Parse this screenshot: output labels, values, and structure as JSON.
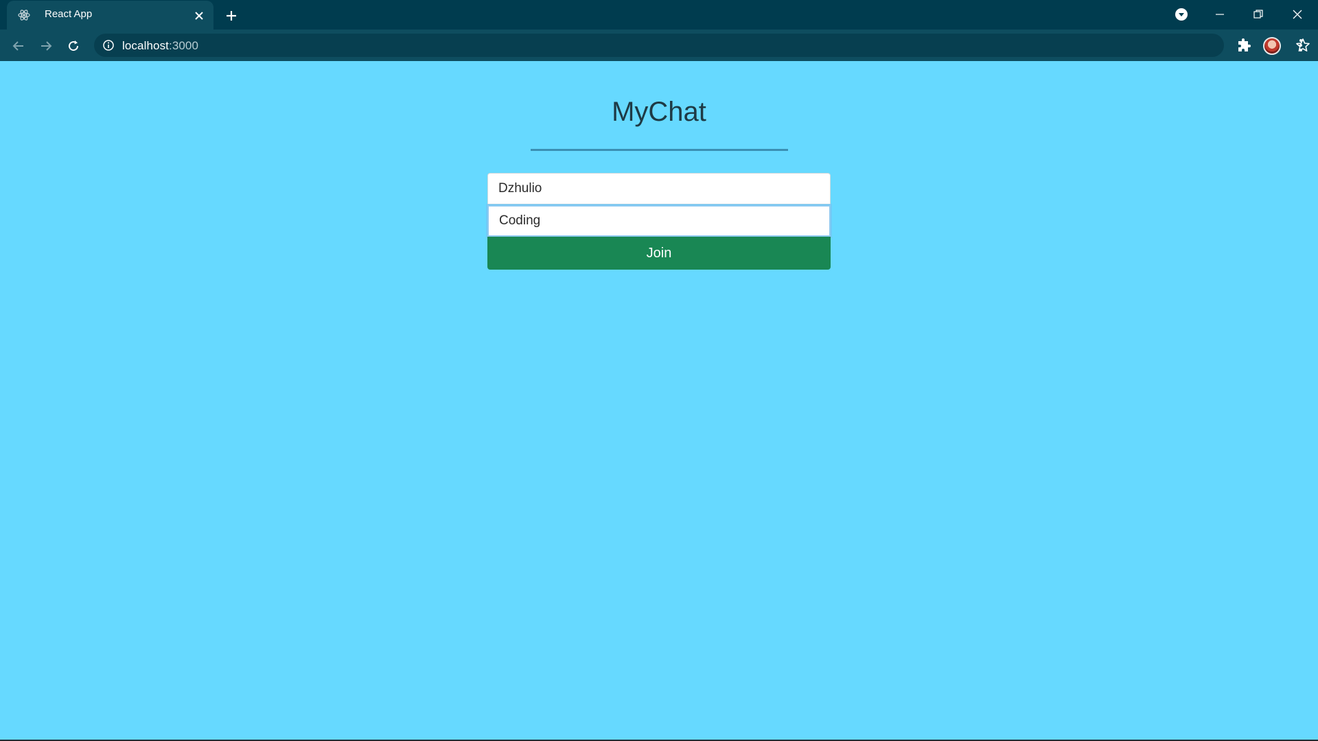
{
  "browser": {
    "tab": {
      "title": "React App",
      "favicon": "react-logo-icon"
    },
    "new_tab_icon": "plus-icon",
    "url": {
      "host": "localhost",
      "port": ":3000"
    },
    "window_controls": [
      "minimize-icon",
      "restore-icon",
      "close-icon"
    ]
  },
  "app": {
    "title": "MyChat",
    "form": {
      "name_value": "Dzhulio",
      "room_value": "Coding",
      "join_label": "Join"
    }
  },
  "colors": {
    "page_background": "#66d9ff",
    "title_bar": "#003c4f",
    "toolbar": "#0e4d5f",
    "join_button": "#198754",
    "title_rule": "#3b8fb3"
  }
}
